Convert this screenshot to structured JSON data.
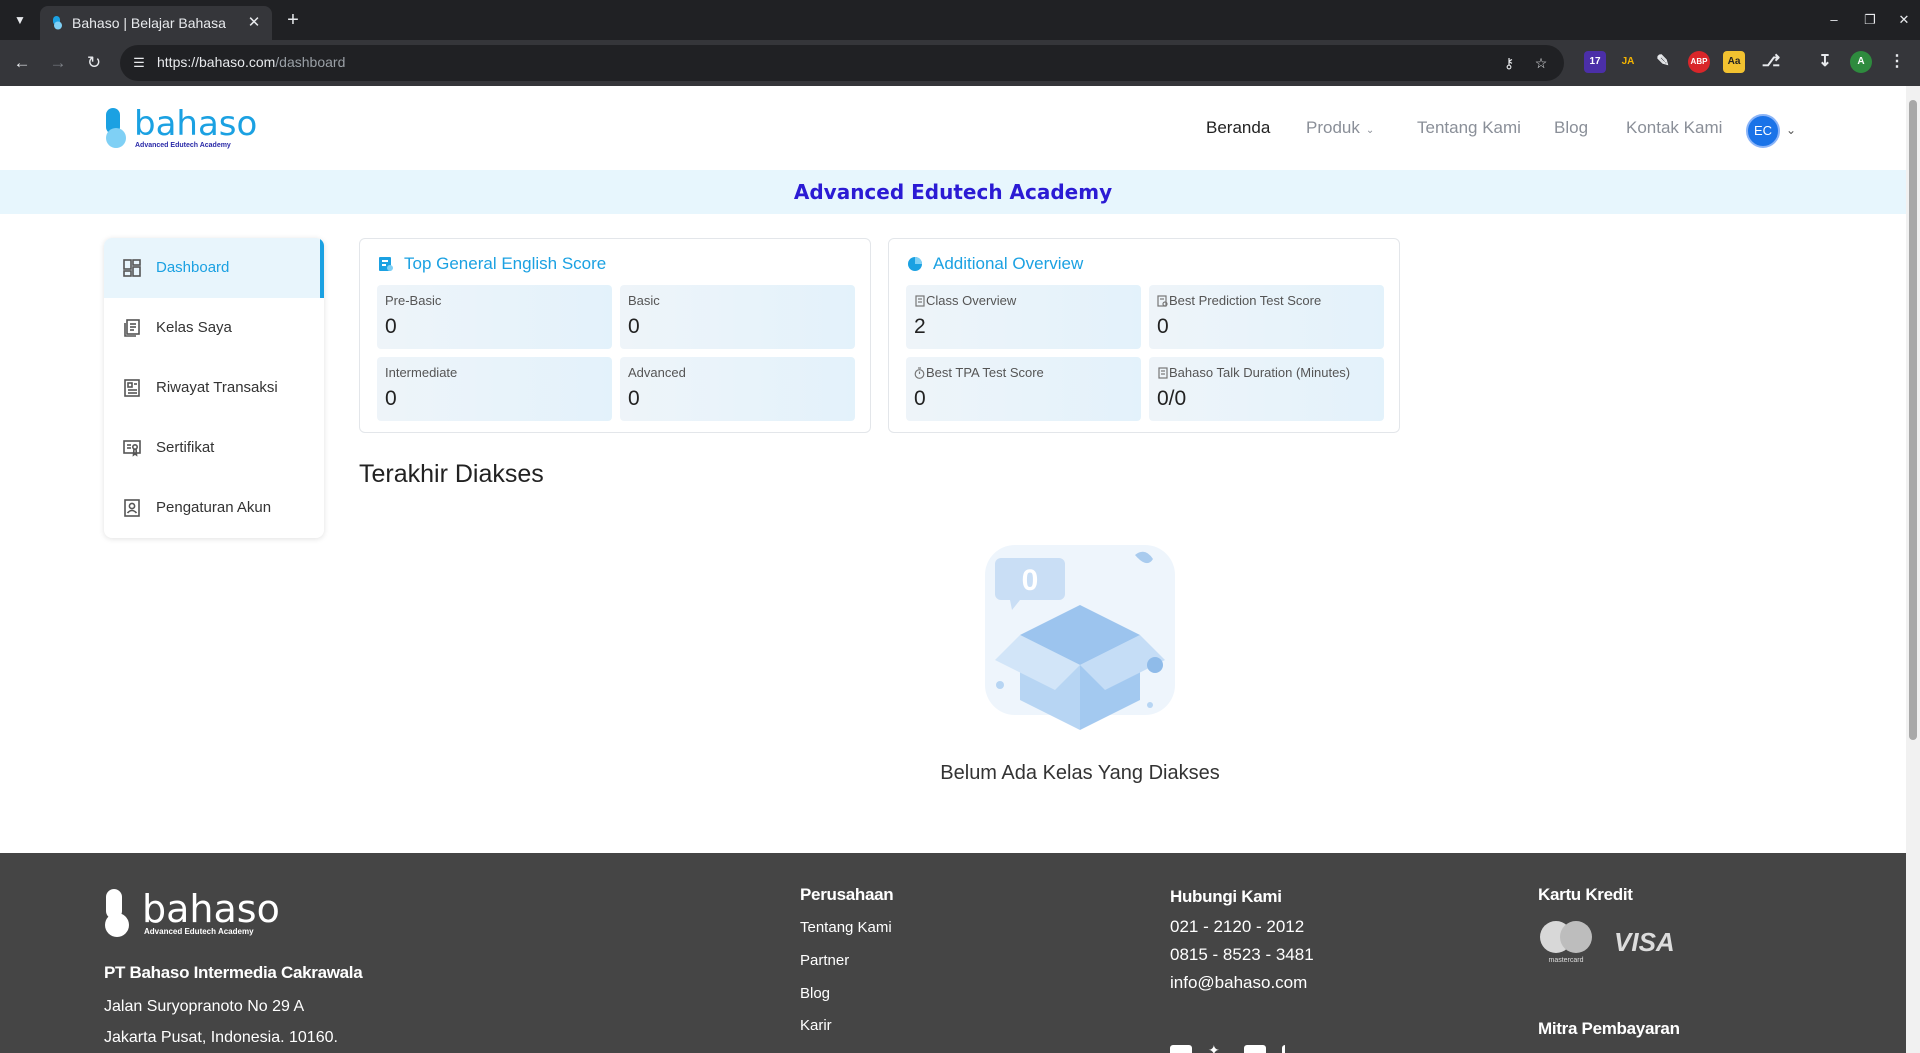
{
  "browser": {
    "tab_title": "Bahaso | Belajar Bahasa",
    "url_host": "https://bahaso.com",
    "url_path": "/dashboard",
    "extension_badge": "17"
  },
  "header": {
    "logo_text": "bahaso",
    "logo_sub": "Advanced Edutech Academy",
    "nav": {
      "home": "Beranda",
      "products": "Produk",
      "about": "Tentang Kami",
      "blog": "Blog",
      "contact": "Kontak Kami"
    },
    "avatar_initials": "EC"
  },
  "banner": {
    "title": "Advanced Edutech Academy"
  },
  "sidebar": {
    "items": [
      {
        "label": "Dashboard",
        "icon": "dashboard-icon"
      },
      {
        "label": "Kelas Saya",
        "icon": "classes-icon"
      },
      {
        "label": "Riwayat Transaksi",
        "icon": "receipt-icon"
      },
      {
        "label": "Sertifikat",
        "icon": "certificate-icon"
      },
      {
        "label": "Pengaturan Akun",
        "icon": "account-icon"
      }
    ]
  },
  "score_card": {
    "title": "Top General English Score",
    "stats": [
      {
        "label": "Pre-Basic",
        "value": "0"
      },
      {
        "label": "Basic",
        "value": "0"
      },
      {
        "label": "Intermediate",
        "value": "0"
      },
      {
        "label": "Advanced",
        "value": "0"
      }
    ]
  },
  "overview_card": {
    "title": "Additional Overview",
    "stats": [
      {
        "label": "Class Overview",
        "value": "2"
      },
      {
        "label": "Best Prediction Test Score",
        "value": "0"
      },
      {
        "label": "Best TPA Test Score",
        "value": "0"
      },
      {
        "label": "Bahaso Talk Duration (Minutes)",
        "value": "0/0"
      }
    ]
  },
  "recent": {
    "title": "Terakhir Diakses",
    "empty_badge": "0",
    "empty_text": "Belum Ada Kelas Yang Diakses"
  },
  "footer": {
    "logo_text": "bahaso",
    "logo_sub": "Advanced Edutech Academy",
    "company": "PT Bahaso Intermedia Cakrawala",
    "address_1": "Jalan Suryopranoto No 29 A",
    "address_2": "Jakarta Pusat, Indonesia. 10160.",
    "company_heading": "Perusahaan",
    "company_links": [
      "Tentang Kami",
      "Partner",
      "Blog",
      "Karir"
    ],
    "contact_heading": "Hubungi Kami",
    "contact": [
      "021 - 2120 - 2012",
      "0815 - 8523 - 3481",
      "info@bahaso.com"
    ],
    "card_heading": "Kartu Kredit",
    "mastercard_label": "mastercard",
    "visa_label": "VISA",
    "payment_heading": "Mitra Pembayaran"
  },
  "colors": {
    "brand": "#1ba1e2",
    "banner_text": "#2b1bd4",
    "footer_bg": "#454545"
  }
}
